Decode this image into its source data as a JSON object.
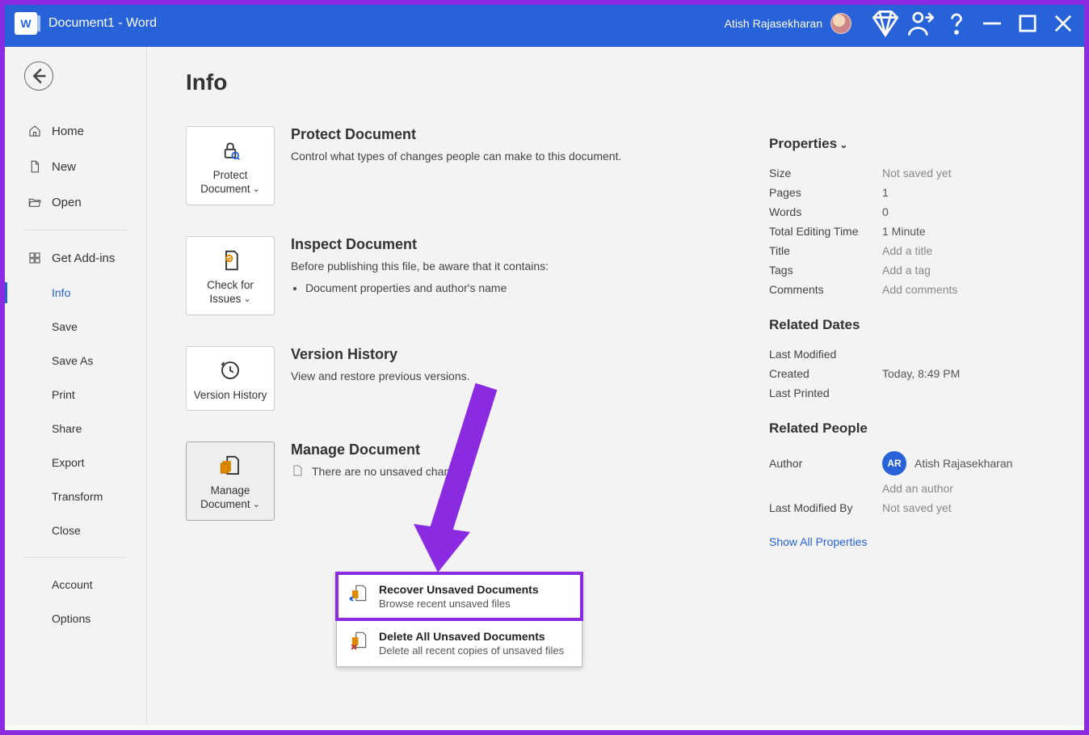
{
  "titlebar": {
    "doc_title": "Document1  -  Word",
    "user_name": "Atish Rajasekharan"
  },
  "sidebar": {
    "home": "Home",
    "new": "New",
    "open": "Open",
    "addins": "Get Add-ins",
    "info": "Info",
    "save": "Save",
    "save_as": "Save As",
    "print": "Print",
    "share": "Share",
    "export": "Export",
    "transform": "Transform",
    "close": "Close",
    "account": "Account",
    "options": "Options"
  },
  "page_title": "Info",
  "protect": {
    "card_label": "Protect Document",
    "heading": "Protect Document",
    "desc": "Control what types of changes people can make to this document."
  },
  "inspect": {
    "card_label": "Check for Issues",
    "heading": "Inspect Document",
    "desc": "Before publishing this file, be aware that it contains:",
    "bullet1": "Document properties and author's name"
  },
  "version_history": {
    "card_label": "Version History",
    "heading": "Version History",
    "desc": "View and restore previous versions."
  },
  "manage": {
    "card_label": "Manage Document",
    "heading": "Manage Document",
    "desc": "There are no unsaved changes.",
    "menu": {
      "recover_title": "Recover Unsaved Documents",
      "recover_desc": "Browse recent unsaved files",
      "delete_title": "Delete All Unsaved Documents",
      "delete_desc": "Delete all recent copies of unsaved files"
    }
  },
  "props": {
    "header": "Properties",
    "size_label": "Size",
    "size_value": "Not saved yet",
    "pages_label": "Pages",
    "pages_value": "1",
    "words_label": "Words",
    "words_value": "0",
    "edit_label": "Total Editing Time",
    "edit_value": "1 Minute",
    "title_label": "Title",
    "title_value": "Add a title",
    "tags_label": "Tags",
    "tags_value": "Add a tag",
    "comments_label": "Comments",
    "comments_value": "Add comments",
    "dates_header": "Related Dates",
    "modified_label": "Last Modified",
    "modified_value": "",
    "created_label": "Created",
    "created_value": "Today, 8:49 PM",
    "printed_label": "Last Printed",
    "printed_value": "",
    "people_header": "Related People",
    "author_label": "Author",
    "author_initials": "AR",
    "author_name": "Atish Rajasekharan",
    "add_author": "Add an author",
    "modifiedby_label": "Last Modified By",
    "modifiedby_value": "Not saved yet",
    "show_all": "Show All Properties"
  }
}
